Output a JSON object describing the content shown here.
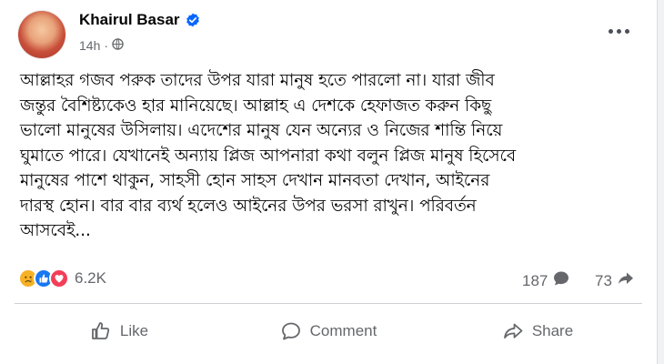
{
  "post": {
    "author": "Khairul Basar",
    "time": "14h",
    "text": "আল্লাহর গজব পরুক তাদের উপর যারা মানুষ হতে পারলো না। যারা জীব\nজন্তুর বৈশিষ্ট্যকেও হার মানিয়েছে। আল্লাহ এ দেশকে হেফাজত করুন কিছু\nভালো মানুষের উসিলায়। এদেশের মানুষ যেন অন্যের ও নিজের শান্তি নিয়ে\nঘুমাতে পারে। যেখানেই অন্যায় প্লিজ আপনারা কথা বলুন প্লিজ মানুষ হিসেবে\nমানুষের পাশে থাকুন, সাহসী হোন সাহস দেখান মানবতা দেখান, আইনের\nদারস্থ হোন। বার বার ব্যর্থ হলেও আইনের উপর ভরসা রাখুন। পরিবর্তন\nআসবেই..."
  },
  "stats": {
    "reactions": "6.2K",
    "comments": "187",
    "shares": "73"
  },
  "actions": {
    "like": "Like",
    "comment": "Comment",
    "share": "Share"
  },
  "icons": {
    "verified": "verified-badge-icon",
    "audience": "globe-icon",
    "more": "more-options-icon",
    "sad": "sad-reaction-icon",
    "like": "like-reaction-icon",
    "love": "love-reaction-icon"
  },
  "colors": {
    "verified": "#0866ff",
    "like": "#1877f2",
    "love": "#f33e58",
    "sad": "#f7b125",
    "muted": "#65676b"
  }
}
